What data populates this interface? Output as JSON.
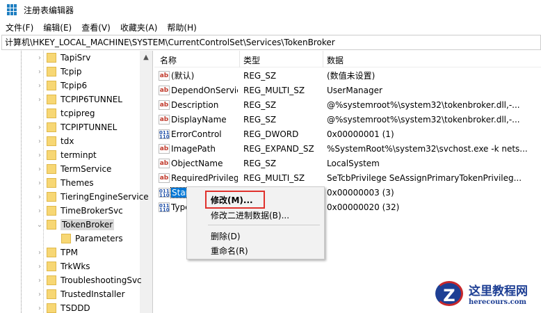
{
  "window": {
    "title": "注册表编辑器"
  },
  "menu": [
    "文件(F)",
    "编辑(E)",
    "查看(V)",
    "收藏夹(A)",
    "帮助(H)"
  ],
  "address": "计算机\\HKEY_LOCAL_MACHINE\\SYSTEM\\CurrentControlSet\\Services\\TokenBroker",
  "tree": [
    {
      "label": "TapiSrv",
      "expand": true
    },
    {
      "label": "Tcpip",
      "expand": true
    },
    {
      "label": "Tcpip6",
      "expand": true
    },
    {
      "label": "TCPIP6TUNNEL",
      "expand": true
    },
    {
      "label": "tcpipreg",
      "expand": false
    },
    {
      "label": "TCPIPTUNNEL",
      "expand": true
    },
    {
      "label": "tdx",
      "expand": true
    },
    {
      "label": "terminpt",
      "expand": true
    },
    {
      "label": "TermService",
      "expand": true
    },
    {
      "label": "Themes",
      "expand": true
    },
    {
      "label": "TieringEngineService",
      "expand": true
    },
    {
      "label": "TimeBrokerSvc",
      "expand": true
    },
    {
      "label": "TokenBroker",
      "expand": true,
      "selected": true,
      "open": true
    },
    {
      "label": "Parameters",
      "child": true
    },
    {
      "label": "TPM",
      "expand": true
    },
    {
      "label": "TrkWks",
      "expand": true
    },
    {
      "label": "TroubleshootingSvc",
      "expand": true
    },
    {
      "label": "TrustedInstaller",
      "expand": true
    },
    {
      "label": "TSDDD",
      "expand": true
    }
  ],
  "columns": {
    "name": "名称",
    "type": "类型",
    "data": "数据"
  },
  "values": [
    {
      "icon": "ab",
      "name": "(默认)",
      "type": "REG_SZ",
      "data": "(数值未设置)"
    },
    {
      "icon": "ab",
      "name": "DependOnService",
      "type": "REG_MULTI_SZ",
      "data": "UserManager"
    },
    {
      "icon": "ab",
      "name": "Description",
      "type": "REG_SZ",
      "data": "@%systemroot%\\system32\\tokenbroker.dll,-..."
    },
    {
      "icon": "ab",
      "name": "DisplayName",
      "type": "REG_SZ",
      "data": "@%systemroot%\\system32\\tokenbroker.dll,-..."
    },
    {
      "icon": "bin",
      "name": "ErrorControl",
      "type": "REG_DWORD",
      "data": "0x00000001 (1)"
    },
    {
      "icon": "ab",
      "name": "ImagePath",
      "type": "REG_EXPAND_SZ",
      "data": "%SystemRoot%\\system32\\svchost.exe -k nets..."
    },
    {
      "icon": "ab",
      "name": "ObjectName",
      "type": "REG_SZ",
      "data": "LocalSystem"
    },
    {
      "icon": "ab",
      "name": "RequiredPrivileges",
      "type": "REG_MULTI_SZ",
      "data": "SeTcbPrivilege SeAssignPrimaryTokenPrivileg..."
    },
    {
      "icon": "bin",
      "name": "Start",
      "type": "",
      "data": "0x00000003 (3)",
      "selected": true
    },
    {
      "icon": "bin",
      "name": "Type",
      "type": "",
      "data": "0x00000020 (32)"
    }
  ],
  "context_menu": {
    "modify": "修改(M)...",
    "modify_binary": "修改二进制数据(B)...",
    "delete": "删除(D)",
    "rename": "重命名(R)"
  },
  "watermark": {
    "cn": "这里教程网",
    "en": "herecours.com"
  }
}
